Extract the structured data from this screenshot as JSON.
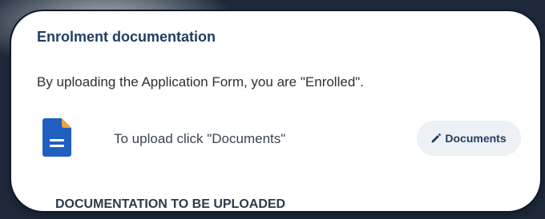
{
  "card": {
    "title": "Enrolment documentation",
    "intro": "By uploading the Application Form, you are \"Enrolled\".",
    "upload_instruction": "To upload click \"Documents\"",
    "documents_button_label": "Documents",
    "section_heading": "DOCUMENTATION TO BE UPLOADED"
  },
  "icons": {
    "document": "document-icon",
    "pencil": "pencil-icon"
  },
  "colors": {
    "title": "#1f3f60",
    "document_icon_body": "#1f5fbf",
    "document_icon_corner": "#f2a23a",
    "button_bg": "#edf1f5"
  }
}
